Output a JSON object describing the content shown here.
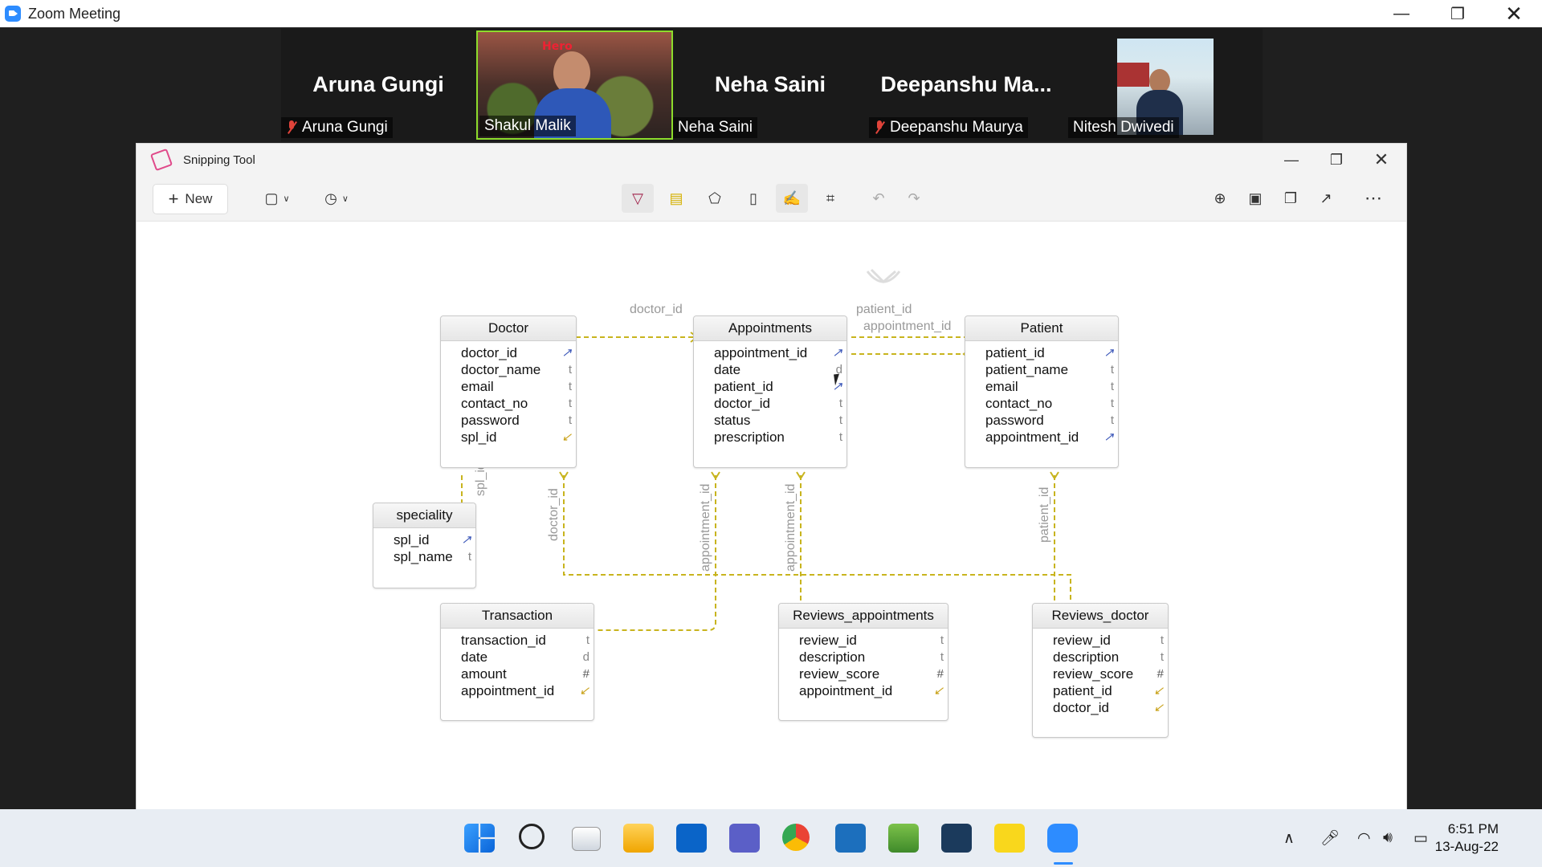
{
  "zoom": {
    "title": "Zoom Meeting",
    "participants": [
      {
        "name": "Aruna Gungi",
        "label": "Aruna Gungi",
        "muted": true,
        "video": false
      },
      {
        "name": "",
        "label": "Shakul Malik",
        "muted": false,
        "video": true,
        "active": true
      },
      {
        "name": "Neha Saini",
        "label": "Neha Saini",
        "muted": false,
        "video": false
      },
      {
        "name": "Deepanshu  Ma...",
        "label": "Deepanshu Maurya",
        "muted": true,
        "video": false
      },
      {
        "name": "",
        "label": "Nitesh Dwivedi",
        "muted": false,
        "video": true
      }
    ]
  },
  "snipping": {
    "title": "Snipping Tool",
    "new_label": "New",
    "tools": [
      "ballpoint-pen",
      "highlighter",
      "eraser",
      "ruler",
      "touch-writing",
      "crop",
      "undo",
      "redo",
      "zoom",
      "save",
      "copy",
      "share",
      "more"
    ]
  },
  "diagram": {
    "tables": {
      "doctor": {
        "title": "Doctor",
        "rows": [
          {
            "name": "doctor_id",
            "type": "key"
          },
          {
            "name": "doctor_name",
            "type": "t"
          },
          {
            "name": "email",
            "type": "t"
          },
          {
            "name": "contact_no",
            "type": "t"
          },
          {
            "name": "password",
            "type": "t"
          },
          {
            "name": "spl_id",
            "type": "fk"
          }
        ]
      },
      "appointments": {
        "title": "Appointments",
        "rows": [
          {
            "name": "appointment_id",
            "type": "key"
          },
          {
            "name": "date",
            "type": "d"
          },
          {
            "name": "patient_id",
            "type": "key"
          },
          {
            "name": "doctor_id",
            "type": "t"
          },
          {
            "name": "status",
            "type": "t"
          },
          {
            "name": "prescription",
            "type": "t"
          }
        ]
      },
      "patient": {
        "title": "Patient",
        "rows": [
          {
            "name": "patient_id",
            "type": "key"
          },
          {
            "name": "patient_name",
            "type": "t"
          },
          {
            "name": "email",
            "type": "t"
          },
          {
            "name": "contact_no",
            "type": "t"
          },
          {
            "name": "password",
            "type": "t"
          },
          {
            "name": "appointment_id",
            "type": "key"
          }
        ]
      },
      "speciality": {
        "title": "speciality",
        "rows": [
          {
            "name": "spl_id",
            "type": "key"
          },
          {
            "name": "spl_name",
            "type": "t"
          }
        ]
      },
      "transaction": {
        "title": "Transaction",
        "rows": [
          {
            "name": "transaction_id",
            "type": "t"
          },
          {
            "name": "date",
            "type": "d"
          },
          {
            "name": "amount",
            "type": "#"
          },
          {
            "name": "appointment_id",
            "type": "fk"
          }
        ]
      },
      "reviews_appointments": {
        "title": "Reviews_appointments",
        "rows": [
          {
            "name": "review_id",
            "type": "t"
          },
          {
            "name": "description",
            "type": "t"
          },
          {
            "name": "review_score",
            "type": "#"
          },
          {
            "name": "appointment_id",
            "type": "fk"
          }
        ]
      },
      "reviews_doctor": {
        "title": "Reviews_doctor",
        "rows": [
          {
            "name": "review_id",
            "type": "t"
          },
          {
            "name": "description",
            "type": "t"
          },
          {
            "name": "review_score",
            "type": "#"
          },
          {
            "name": "patient_id",
            "type": "fk"
          },
          {
            "name": "doctor_id",
            "type": "fk"
          }
        ]
      }
    },
    "labels": {
      "doctor_appt": "doctor_id",
      "patient_appt": "patient_id",
      "appt_patient": "appointment_id",
      "spl": "spl_id",
      "doctor_rev": "doctor_id",
      "appt_trans": "appointment_id",
      "appt_rev": "appointment_id",
      "patient_rev": "patient_id"
    }
  },
  "taskbar": {
    "time": "6:51 PM",
    "date": "13-Aug-22"
  }
}
